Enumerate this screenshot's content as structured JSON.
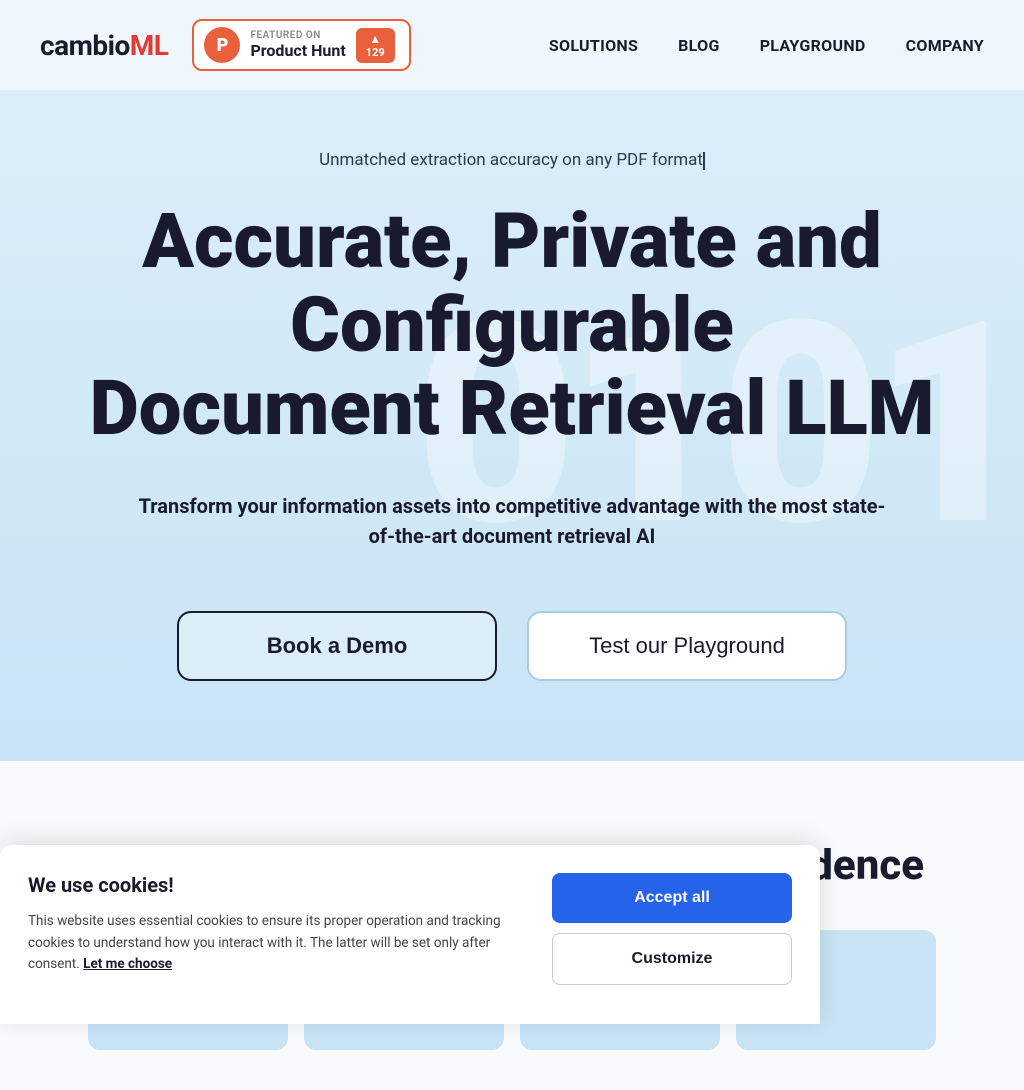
{
  "brand": {
    "logo_cambio": "cambio",
    "logo_ml": "ML"
  },
  "product_hunt": {
    "featured_label": "FEATURED ON",
    "name": "Product Hunt",
    "icon_letter": "P",
    "upvote_count": "129",
    "arrow": "▲"
  },
  "nav": {
    "solutions": "SOLUTIONS",
    "blog": "BLOG",
    "playground": "PLAYGROUND",
    "company": "COMPANY"
  },
  "hero": {
    "subtitle": "Unmatched extraction accuracy on any PDF format",
    "title_line1": "Accurate, Private and Configurable",
    "title_line2": "Document Retrieval LLM",
    "description": "Transform your information assets into competitive advantage with the most state-of-the-art document retrieval AI",
    "bg_numbers": "0 1 0 1",
    "btn_demo": "Book a Demo",
    "btn_playground": "Test our Playground"
  },
  "lower": {
    "title": "Extract key information with full confidence"
  },
  "cookie": {
    "title": "We use cookies!",
    "text": "This website uses essential cookies to ensure its proper operation and tracking cookies to understand how you interact with it. The latter will be set only after consent.",
    "link_text": "Let me choose",
    "btn_accept": "Accept all",
    "btn_customize": "Customize"
  }
}
